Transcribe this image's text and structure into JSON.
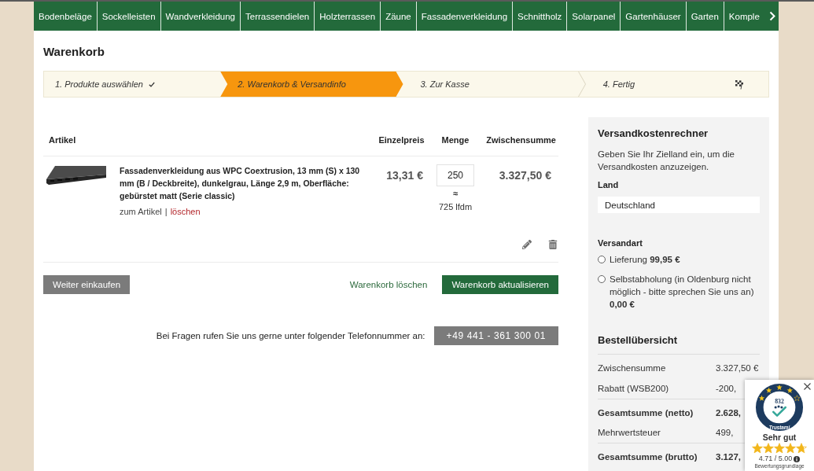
{
  "nav": {
    "items": [
      "Bodenbeläge",
      "Sockelleisten",
      "Wandverkleidung",
      "Terrassendielen",
      "Holzterrassen",
      "Zäune",
      "Fassadenverkleidung",
      "Schnittholz",
      "Solarpanel",
      "Gartenhäuser",
      "Garten",
      "Komple"
    ]
  },
  "page_title": "Warenkorb",
  "steps": [
    {
      "label": "1. Produkte auswählen",
      "selected": false,
      "done": true
    },
    {
      "label": "2. Warenkorb & Versandinfo",
      "selected": true,
      "done": false
    },
    {
      "label": "3. Zur Kasse",
      "selected": false,
      "done": false
    },
    {
      "label": "4. Fertig",
      "selected": false,
      "done": false
    }
  ],
  "cart": {
    "columns": [
      "Artikel",
      "Einzelpreis",
      "Menge",
      "Zwischensumme"
    ],
    "items": [
      {
        "name": "Fassadenverkleidung aus WPC Coextrusion, 13 mm (S) x 130 mm (B / Deckbreite), dunkelgrau, Länge 2,9 m, Oberfläche: gebürstet matt (Serie classic)",
        "view_link": "zum Artikel",
        "separator": "|",
        "remove_link": "löschen",
        "unit_price": "13,31 €",
        "quantity": "250",
        "approx": "≈",
        "length": "725 lfdm",
        "subtotal": "3.327,50 €"
      }
    ],
    "buttons": [
      {
        "label": "Weiter einkaufen",
        "kind": "secondary"
      },
      {
        "label": "Warenkorb löschen",
        "kind": "link"
      },
      {
        "label": "Warenkorb aktualisieren",
        "kind": "primary"
      }
    ],
    "phone": {
      "text": "Bei Fragen rufen Sie uns gerne unter folgender Telefonnummer an:",
      "number": "+49 441 - 361 300 01"
    }
  },
  "sidebar": {
    "shipping": {
      "title": "Versandkostenrechner",
      "description": "Geben Sie Ihr Zielland ein, um die Versandkosten anzuzeigen.",
      "country_label": "Land",
      "country_value": "Deutschland",
      "method_label": "Versandart",
      "methods": [
        {
          "label": "Lieferung **99,95 €**",
          "selected": false
        },
        {
          "label": "Selbstabholung (in Oldenburg nicht möglich - bitte sprechen Sie uns an) **0,00 €**",
          "selected": false
        }
      ]
    },
    "summary": {
      "title": "Bestellübersicht",
      "rows": [
        {
          "label": "Zwischensumme",
          "value": "3.327,50 €",
          "kind": "line"
        },
        {
          "label": "Rabatt (WSB200)",
          "value": "-200,",
          "kind": "line"
        },
        {
          "label": "Gesamtsumme (netto)",
          "value": "2.628,",
          "kind": "total"
        },
        {
          "label": "Mehrwertsteuer",
          "value": "499,",
          "kind": "line"
        },
        {
          "label": "Gesamtsumme (brutto)",
          "value": "3.127,",
          "kind": "total"
        }
      ]
    }
  },
  "trust_badge": {
    "count": "832",
    "brand": "Trustami",
    "verdict": "Sehr gut",
    "stars": 4.71,
    "score": "4.71 / 5.00",
    "footnote": "Bewertungsgrundlage"
  }
}
